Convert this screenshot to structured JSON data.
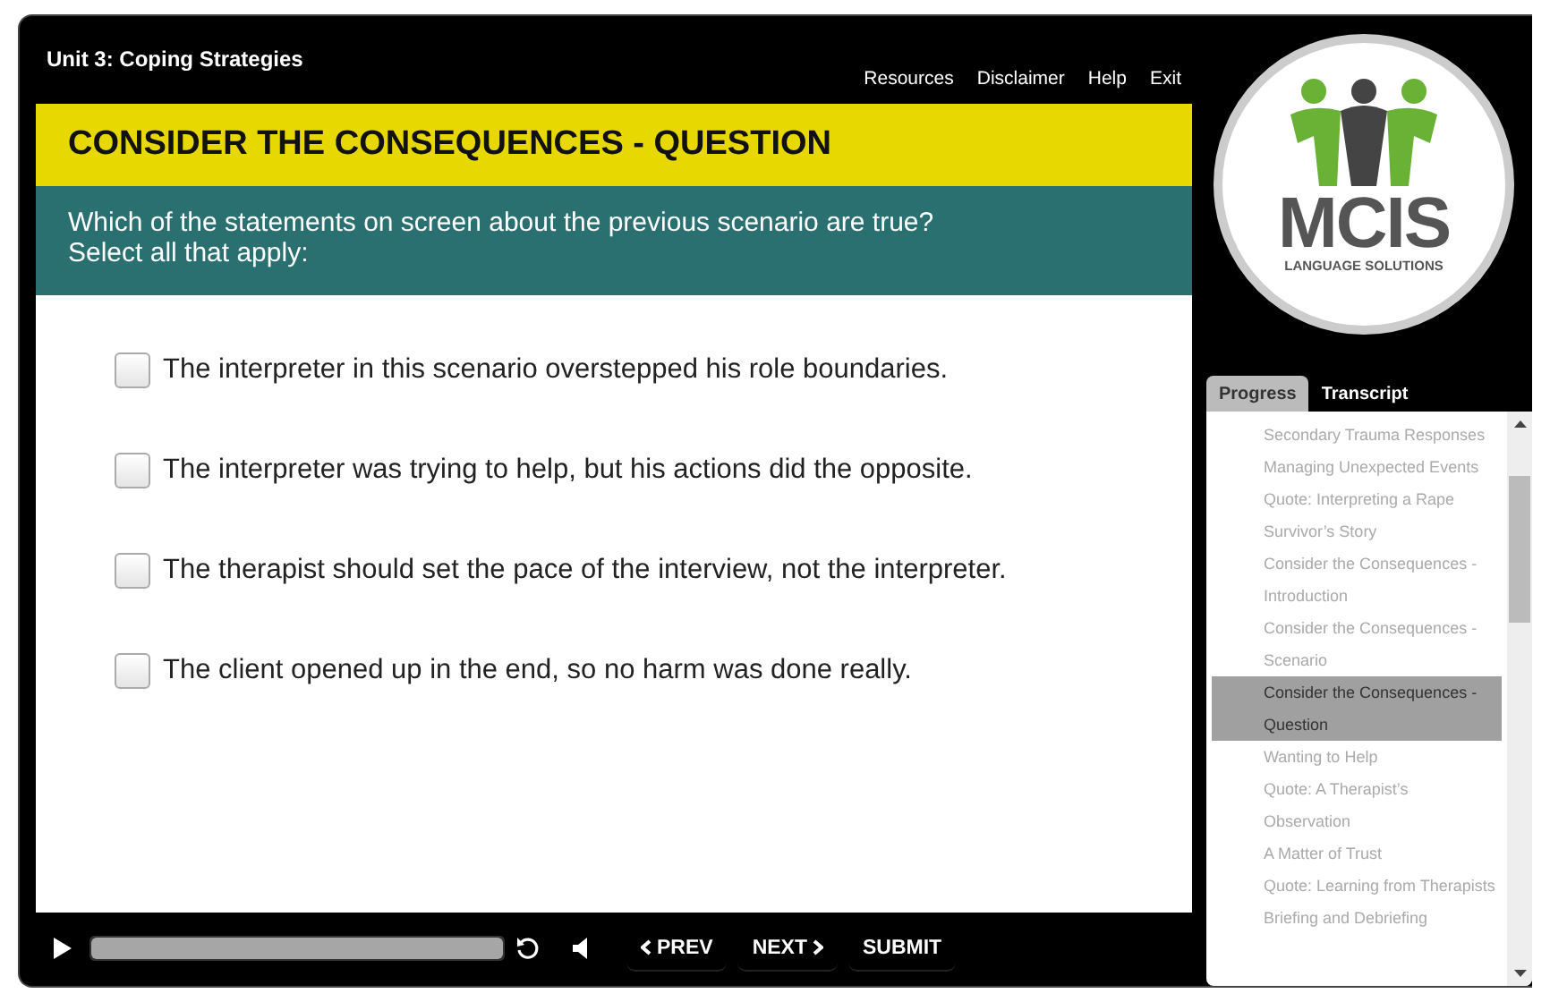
{
  "header": {
    "title": "Unit 3: Coping Strategies",
    "links": [
      "Resources",
      "Disclaimer",
      "Help",
      "Exit"
    ]
  },
  "slide": {
    "heading": "CONSIDER THE CONSEQUENCES - QUESTION",
    "prompt": "Which of the statements on screen about the previous scenario are true?\nSelect all that apply:",
    "options": [
      {
        "label": "The interpreter in this scenario overstepped his role boundaries.",
        "checked": false
      },
      {
        "label": "The interpreter was trying to help, but his actions did the opposite.",
        "checked": false
      },
      {
        "label": "The therapist should set the pace of the interview, not the interpreter.",
        "checked": false
      },
      {
        "label": "The client opened up in the end, so no harm was done really.",
        "checked": false
      }
    ]
  },
  "logo": {
    "name": "MCIS",
    "tagline": "LANGUAGE SOLUTIONS"
  },
  "tabs": [
    {
      "label": "Progress",
      "selected": true
    },
    {
      "label": "Transcript",
      "selected": false
    }
  ],
  "outline": [
    {
      "label": "Secondary Trauma Responses",
      "selected": false
    },
    {
      "label": "Managing Unexpected Events",
      "selected": false
    },
    {
      "label": "Quote: Interpreting a Rape Survivor’s Story",
      "selected": false
    },
    {
      "label": "Consider the Consequences - Introduction",
      "selected": false
    },
    {
      "label": "Consider the Consequences - Scenario",
      "selected": false
    },
    {
      "label": "Consider the Consequences - Question",
      "selected": true
    },
    {
      "label": "Wanting to Help",
      "selected": false
    },
    {
      "label": "Quote: A Therapist’s Observation",
      "selected": false
    },
    {
      "label": "A Matter of Trust",
      "selected": false
    },
    {
      "label": "Quote: Learning from Therapists",
      "selected": false
    },
    {
      "label": "Briefing and Debriefing",
      "selected": false
    }
  ],
  "controls": {
    "seek": {
      "level": 1
    },
    "prev": "PREV",
    "next": "NEXT",
    "submit": "SUBMIT"
  }
}
